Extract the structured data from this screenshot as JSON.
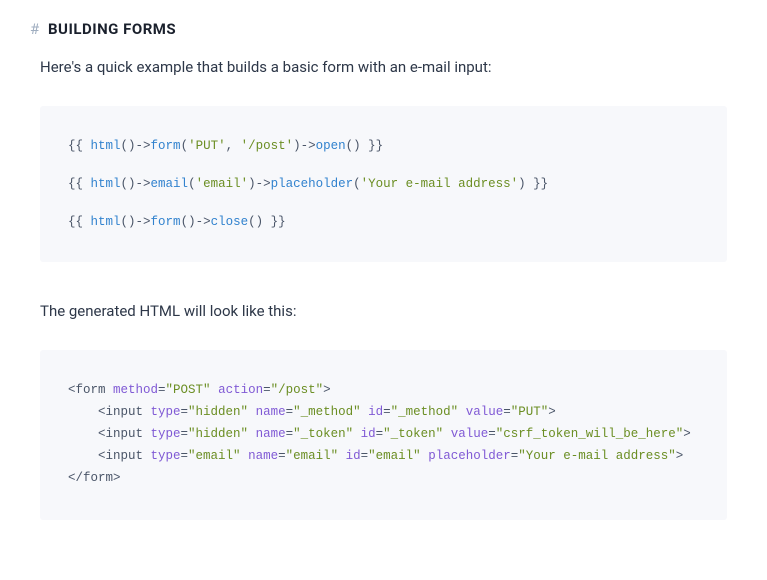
{
  "heading": {
    "hash": "#",
    "title": "BUILDING FORMS"
  },
  "para1": "Here's a quick example that builds a basic form with an e-mail input:",
  "code1": {
    "l1": {
      "p1": "{{ ",
      "fn1": "html",
      "p2": "()->",
      "fn2": "form",
      "p3": "(",
      "s1": "'PUT'",
      "p4": ", ",
      "s2": "'/post'",
      "p5": ")->",
      "fn3": "open",
      "p6": "() }}"
    },
    "l2": {
      "p1": "{{ ",
      "fn1": "html",
      "p2": "()->",
      "fn2": "email",
      "p3": "(",
      "s1": "'email'",
      "p4": ")->",
      "fn3": "placeholder",
      "p5": "(",
      "s2": "'Your e-mail address'",
      "p6": ") }}"
    },
    "l3": {
      "p1": "{{ ",
      "fn1": "html",
      "p2": "()->",
      "fn2": "form",
      "p3": "()->",
      "fn3": "close",
      "p4": "() }}"
    }
  },
  "para2": "The generated HTML will look like this:",
  "code2": {
    "l1": {
      "p1": "<form ",
      "a1": "method",
      "p2": "=",
      "v1": "\"POST\"",
      "p3": " ",
      "a2": "action",
      "p4": "=",
      "v2": "\"/post\"",
      "p5": ">"
    },
    "l2": {
      "p1": "    <input ",
      "a1": "type",
      "p2": "=",
      "v1": "\"hidden\"",
      "p3": " ",
      "a2": "name",
      "p4": "=",
      "v2": "\"_method\"",
      "p5": " ",
      "a3": "id",
      "p6": "=",
      "v3": "\"_method\"",
      "p7": " ",
      "a4": "value",
      "p8": "=",
      "v4": "\"PUT\"",
      "p9": ">"
    },
    "l3": {
      "p1": "    <input ",
      "a1": "type",
      "p2": "=",
      "v1": "\"hidden\"",
      "p3": " ",
      "a2": "name",
      "p4": "=",
      "v2": "\"_token\"",
      "p5": " ",
      "a3": "id",
      "p6": "=",
      "v3": "\"_token\"",
      "p7": " ",
      "a4": "value",
      "p8": "=",
      "v4": "\"csrf_token_will_be_here\"",
      "p9": ">"
    },
    "l4": {
      "p1": "    <input ",
      "a1": "type",
      "p2": "=",
      "v1": "\"email\"",
      "p3": " ",
      "a2": "name",
      "p4": "=",
      "v2": "\"email\"",
      "p5": " ",
      "a3": "id",
      "p6": "=",
      "v3": "\"email\"",
      "p7": " ",
      "a4": "placeholder",
      "p8": "=",
      "v4": "\"Your e-mail address\"",
      "p9": ">"
    },
    "l5": {
      "p1": "</form>"
    }
  }
}
